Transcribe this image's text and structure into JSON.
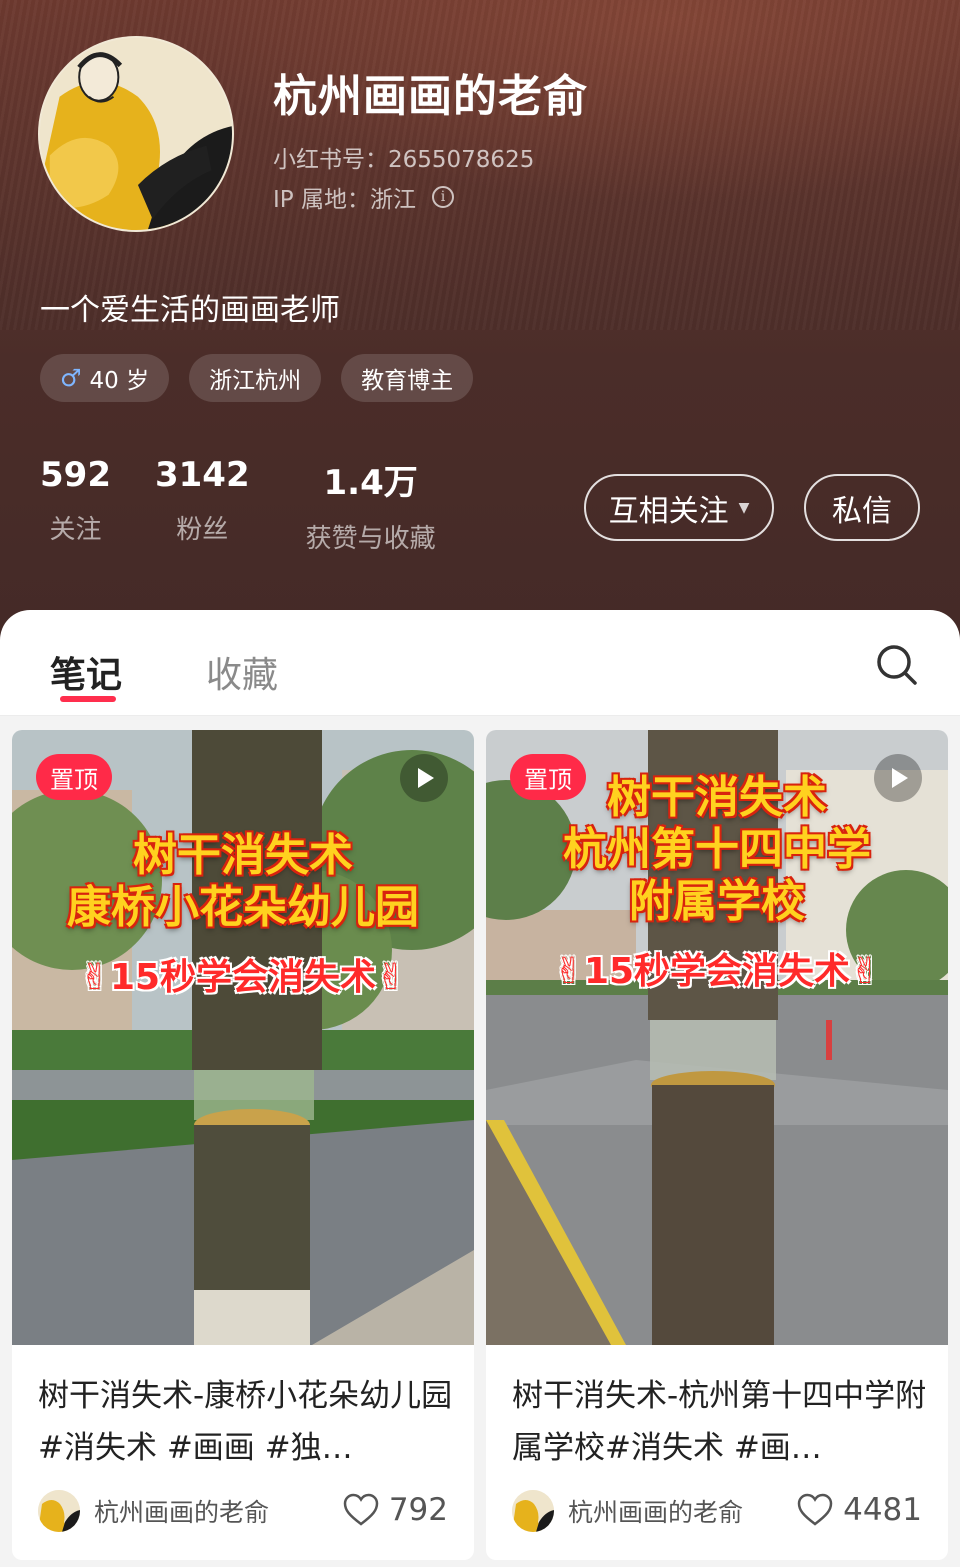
{
  "profile": {
    "name": "杭州画画的老俞",
    "id_line": "小红书号：2655078625",
    "ip_line": "IP 属地：浙江",
    "bio": "一个爱生活的画画老师",
    "tags": [
      {
        "label": "40 岁",
        "icon": "male-icon"
      },
      {
        "label": "浙江杭州"
      },
      {
        "label": "教育博主"
      }
    ],
    "stats": [
      {
        "value": "592",
        "label": "关注"
      },
      {
        "value": "3142",
        "label": "粉丝"
      },
      {
        "value": "1.4万",
        "label": "获赞与收藏"
      }
    ],
    "follow_button": "互相关注",
    "message_button": "私信"
  },
  "tabs": [
    {
      "label": "笔记",
      "active": true
    },
    {
      "label": "收藏",
      "active": false
    }
  ],
  "notes": [
    {
      "pin": "置顶",
      "overlay_lines": [
        "树干消失术",
        "康桥小花朵幼儿园"
      ],
      "overlay_sub": "✌15秒学会消失术✌",
      "title": "树干消失术-康桥小花朵幼儿园#消失术 #画画 #独…",
      "author": "杭州画画的老俞",
      "likes": "792"
    },
    {
      "pin": "置顶",
      "overlay_lines": [
        "树干消失术",
        "杭州第十四中学",
        "附属学校"
      ],
      "overlay_sub": "✌15秒学会消失术✌",
      "title": "树干消失术-杭州第十四中学附属学校#消失术 #画…",
      "author": "杭州画画的老俞",
      "likes": "4481"
    }
  ],
  "colors": {
    "accent": "#ff2e4d",
    "header_bg": "#4b2d29",
    "overlay_yellow": "#ffd21f"
  }
}
